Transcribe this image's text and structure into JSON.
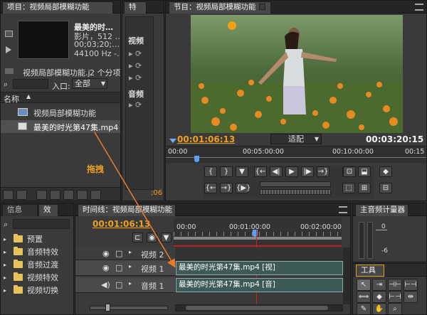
{
  "project": {
    "tab": "项目：视频局部模糊功能",
    "clip_name": "最美的时…",
    "clip_type": "影片，512 …",
    "clip_duration": "00;03;20;…",
    "clip_audio": "44100 Hz -…",
    "folder_name": "视频局部模糊功能.j",
    "folder_count": "2 个分项",
    "entry_label": "入口:",
    "entry_value": "全部",
    "col_name": "名称",
    "items": [
      "视频局部模糊功能",
      "最美的时光第47集.mp4"
    ]
  },
  "effects_panel": {
    "tab": "特",
    "video_header": "视频",
    "audio_header": "音频",
    "clip_time": ";06"
  },
  "program": {
    "tab": "节目：视频局部模糊功能",
    "current_time": "00:01:06:13",
    "fit_label": "适配",
    "duration": "00:03:20:15",
    "ruler": [
      "00:00",
      "00:05:00:00",
      "00:10:00:00",
      "00:15"
    ],
    "playhead_fraction": 0.117
  },
  "info_panel": {
    "tab_info": "信息",
    "tab_effects": "效",
    "items": [
      "预置",
      "音频特效",
      "音频过渡",
      "视频特效",
      "视频切换"
    ]
  },
  "annotation": {
    "drag_label": "拖拽",
    "arrow_color": "#f07a2a"
  },
  "timeline": {
    "tab": "时间线：视频局部模糊功能",
    "current_time": "00:01:06:13",
    "ruler": [
      "00:00",
      "00:01:00:00",
      "00:02:00:00"
    ],
    "tracks": [
      {
        "name": "视频 2",
        "clip": ""
      },
      {
        "name": "视频 1",
        "clip": "最美的时光第47集.mp4 [视]"
      },
      {
        "name": "音频 1",
        "clip": "最美的时光第47集.mp4 [音]"
      }
    ]
  },
  "audio_meter": {
    "tab": "主音频计量器",
    "marks": [
      "0",
      "-6"
    ]
  },
  "tools": {
    "tab": "工具",
    "icons": [
      "selection-tool-icon",
      "track-select-icon",
      "ripple-edit-icon",
      "rolling-edit-icon",
      "rate-stretch-icon",
      "razor-icon",
      "slip-icon",
      "slide-icon",
      "pen-icon",
      "hand-icon",
      "zoom-icon"
    ]
  },
  "colors": {
    "accent": "#f0a020",
    "clip_fill": "#3e5a57",
    "playhead": "#d02020",
    "panel": "#3a3a3a"
  }
}
